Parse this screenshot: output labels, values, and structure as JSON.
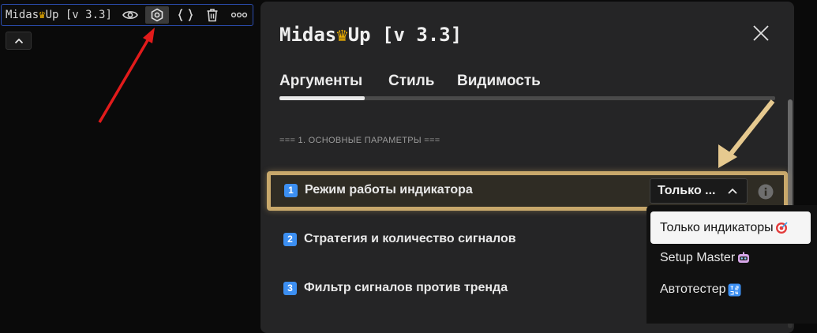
{
  "toolbar": {
    "title_pre": "Midas",
    "title_post": "Up [v 3.3]",
    "icons": [
      "eye-icon",
      "settings-icon",
      "braces-icon",
      "trash-icon",
      "more-icon"
    ],
    "collapse_icon": "chevron-up-icon"
  },
  "dialog": {
    "title_pre": "Midas",
    "title_post": "Up [v 3.3]",
    "close_icon": "close-icon",
    "tabs": [
      {
        "label": "Аргументы",
        "active": true
      },
      {
        "label": "Стиль",
        "active": false
      },
      {
        "label": "Видимость",
        "active": false
      }
    ],
    "section_header": "=== 1. ОСНОВНЫЕ ПАРАМЕТРЫ ===",
    "rows": [
      {
        "num": "1",
        "label": "Режим работы индикатора",
        "value": "Только ..."
      },
      {
        "num": "2",
        "label": "Стратегия и количество сигналов"
      },
      {
        "num": "3",
        "label": "Фильтр сигналов против тренда"
      }
    ]
  },
  "dropdown": {
    "options": [
      {
        "label": "Только индикаторы",
        "selected": true,
        "icon": "target-emoji"
      },
      {
        "label": "Setup Master",
        "selected": false,
        "icon": "robot-emoji"
      },
      {
        "label": "Автотестер",
        "selected": false,
        "icon": "numbers-emoji"
      }
    ]
  },
  "colors": {
    "accent_gold": "#c8a86b",
    "arrow_red": "#e21b1b",
    "badge_blue": "#3c8ff2",
    "crown": "#f4b400"
  }
}
